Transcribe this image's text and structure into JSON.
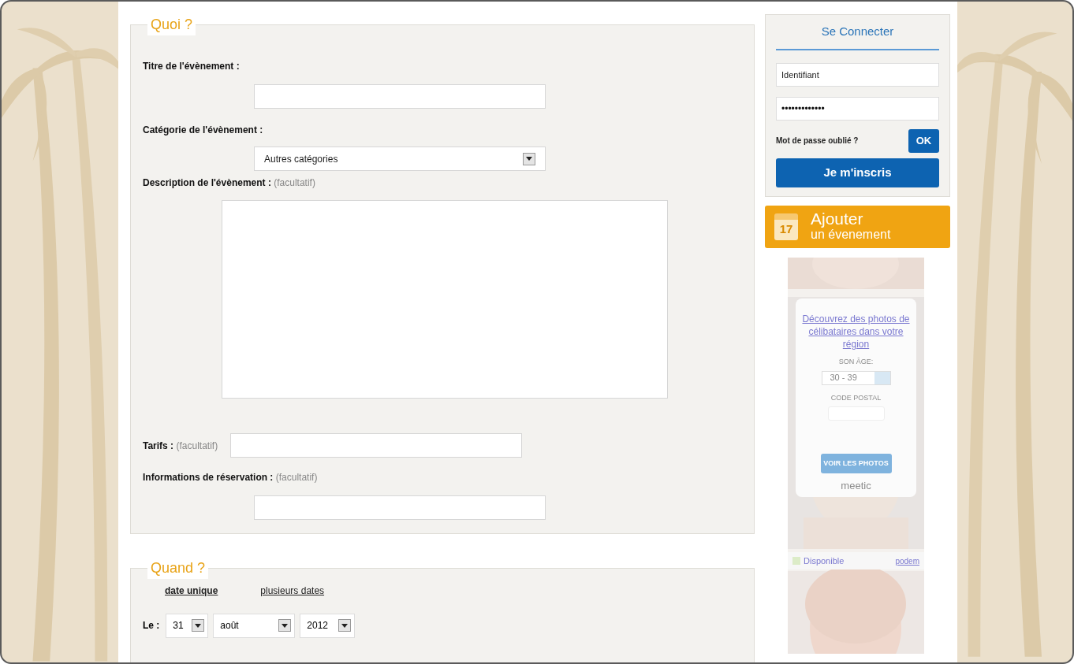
{
  "what": {
    "legend": "Quoi ?",
    "fields": [
      {
        "kind": "input",
        "label": "Titre de l'évènement :"
      },
      {
        "kind": "select",
        "label": "Catégorie de l'évènement :",
        "value": "Autres catégories"
      },
      {
        "kind": "textarea",
        "label": "Description de l'évènement :",
        "note": "(facultatif)"
      },
      {
        "kind": "inline",
        "label": "Tarifs :",
        "note": "(facultatif)"
      },
      {
        "kind": "input",
        "label": "Informations de réservation :",
        "note": "(facultatif)"
      }
    ]
  },
  "when": {
    "legend": "Quand ?",
    "tabs": [
      {
        "label": "date unique",
        "selected": true
      },
      {
        "label": "plusieurs dates",
        "selected": false
      }
    ],
    "date_label": "Le :",
    "selects": [
      {
        "value": "31"
      },
      {
        "value": "août"
      },
      {
        "value": "2012"
      }
    ]
  },
  "login": {
    "title": "Se Connecter",
    "username": "Identifiant",
    "password": "•••••••••••••",
    "forgot": "Mot de passe oublié ?",
    "ok": "OK",
    "register": "Je m'inscris"
  },
  "add_event": {
    "line1": "Ajouter",
    "line2": "un évenement",
    "day": "17"
  },
  "ad": {
    "headline": "Découvrez des photos de célibataires dans votre région",
    "age_label": "SON ÂGE:",
    "age_value": "30 - 39",
    "postal_label": "CODE POSTAL",
    "button": "VOIR LES PHOTOS",
    "logo": "meetic",
    "status": "Disponible",
    "link": "podem"
  }
}
